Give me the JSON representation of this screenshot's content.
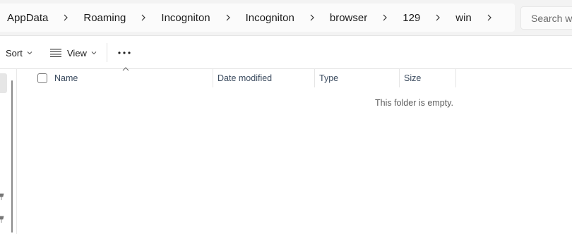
{
  "breadcrumb": {
    "items": [
      {
        "label": "AppData"
      },
      {
        "label": "Roaming"
      },
      {
        "label": "Incogniton"
      },
      {
        "label": "Incogniton"
      },
      {
        "label": "browser"
      },
      {
        "label": "129"
      },
      {
        "label": "win"
      }
    ]
  },
  "search": {
    "placeholder": "Search wi"
  },
  "toolbar": {
    "sort_label": "Sort",
    "view_label": "View",
    "icons": {
      "view": "list-view-icon",
      "more": "more-options-icon",
      "chevron": "chevron-down-icon"
    }
  },
  "columns": {
    "name": "Name",
    "date_modified": "Date modified",
    "type": "Type",
    "size": "Size"
  },
  "main": {
    "empty_message": "This folder is empty."
  },
  "colors": {
    "accent": "#0067c0",
    "header_text": "#3a4a5e"
  }
}
